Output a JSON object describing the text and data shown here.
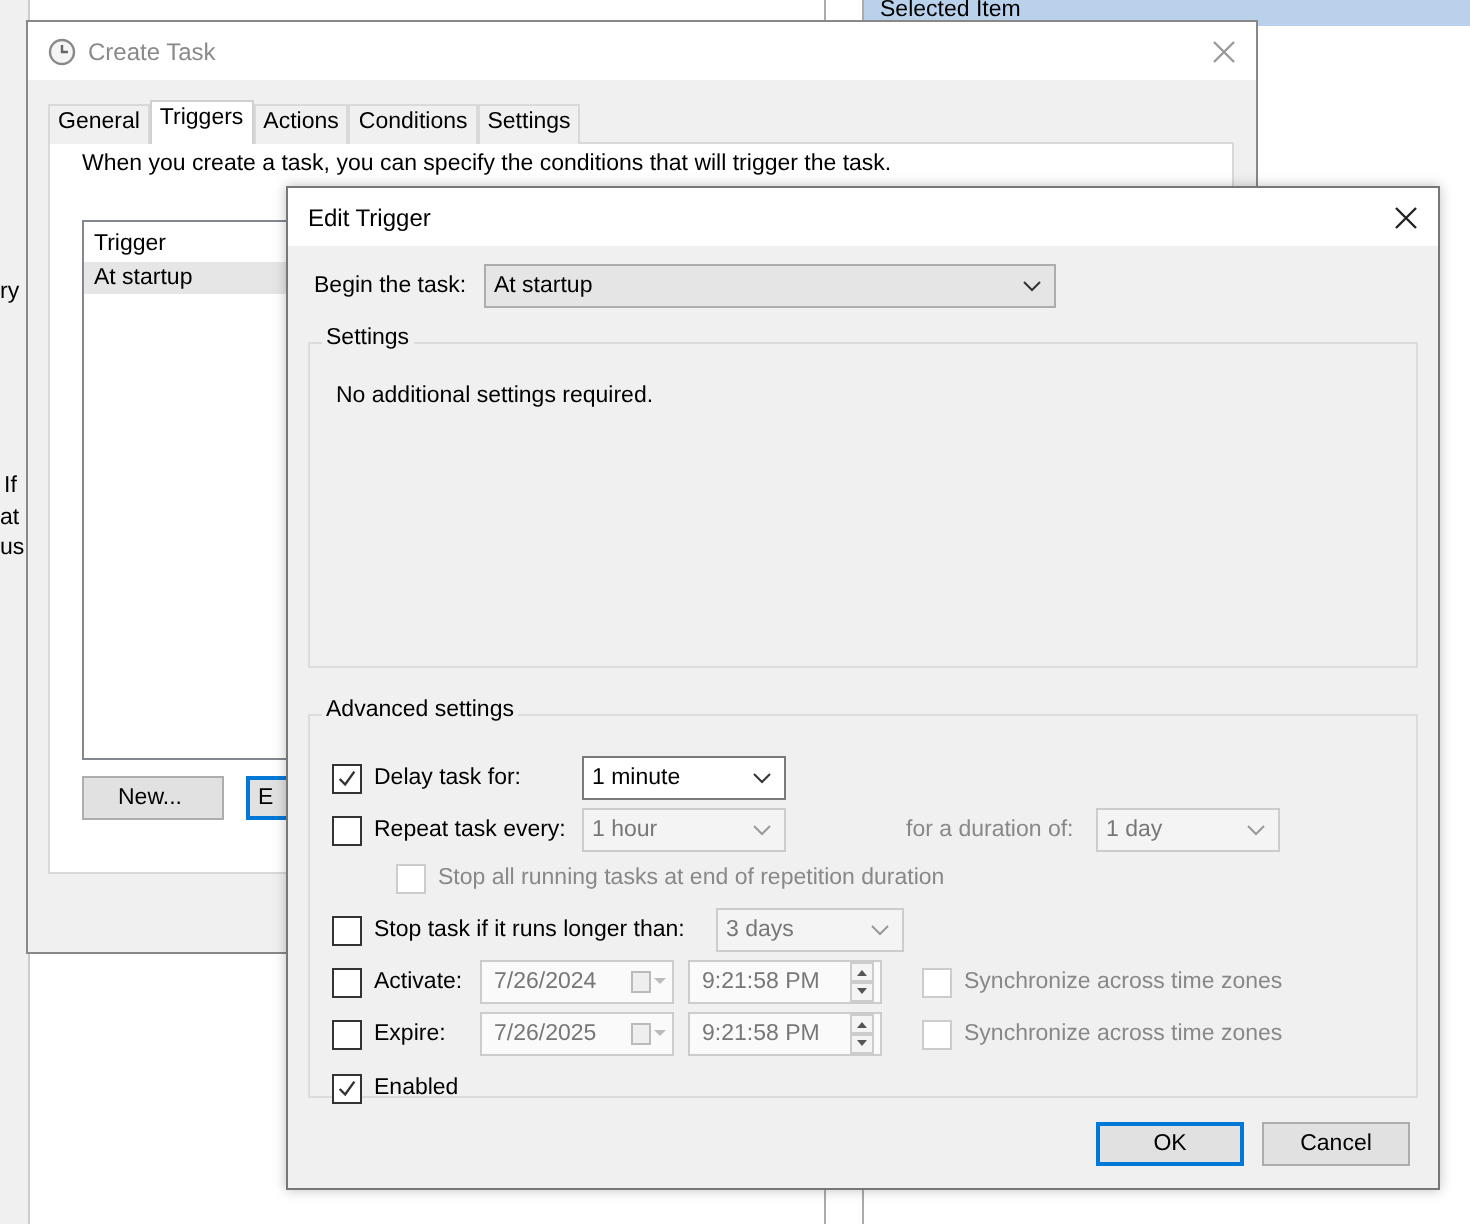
{
  "background": {
    "header": "Selected Item",
    "fragments": [
      "ry",
      "If",
      "at",
      "us"
    ]
  },
  "create_task": {
    "title": "Create Task",
    "tabs": [
      {
        "label": "General",
        "selected": false
      },
      {
        "label": "Triggers",
        "selected": true
      },
      {
        "label": "Actions",
        "selected": false
      },
      {
        "label": "Conditions",
        "selected": false
      },
      {
        "label": "Settings",
        "selected": false
      }
    ],
    "description": "When you create a task, you can specify the conditions that will trigger the task.",
    "list": {
      "header": "Trigger",
      "rows": [
        {
          "text": "At startup",
          "selected": true
        }
      ]
    },
    "buttons": [
      {
        "label": "New...",
        "default": false
      },
      {
        "label": "E",
        "default": true
      }
    ]
  },
  "edit_trigger": {
    "title": "Edit Trigger",
    "begin_label": "Begin the task:",
    "begin_value": "At startup",
    "settings": {
      "title": "Settings",
      "message": "No additional settings required."
    },
    "advanced": {
      "title": "Advanced settings",
      "delay": {
        "label": "Delay task for:",
        "checked": true,
        "value": "1 minute",
        "disabled": false
      },
      "repeat": {
        "label": "Repeat task every:",
        "checked": false,
        "value": "1 hour",
        "disabled": true,
        "duration_label": "for a duration of:",
        "duration_value": "1 day"
      },
      "stop_all": {
        "label": "Stop all running tasks at end of repetition duration",
        "checked": false,
        "disabled": true
      },
      "stop_if": {
        "label": "Stop task if it runs longer than:",
        "checked": false,
        "value": "3 days",
        "disabled": true
      },
      "activate": {
        "label": "Activate:",
        "checked": false,
        "date": "7/26/2024",
        "time": "9:21:58 PM",
        "sync_label": "Synchronize across time zones",
        "sync_checked": false,
        "disabled": true
      },
      "expire": {
        "label": "Expire:",
        "checked": false,
        "date": "7/26/2025",
        "time": "9:21:58 PM",
        "sync_label": "Synchronize across time zones",
        "sync_checked": false,
        "disabled": true
      },
      "enabled": {
        "label": "Enabled",
        "checked": true
      }
    },
    "buttons": [
      {
        "label": "OK",
        "default": true
      },
      {
        "label": "Cancel",
        "default": false
      }
    ]
  }
}
